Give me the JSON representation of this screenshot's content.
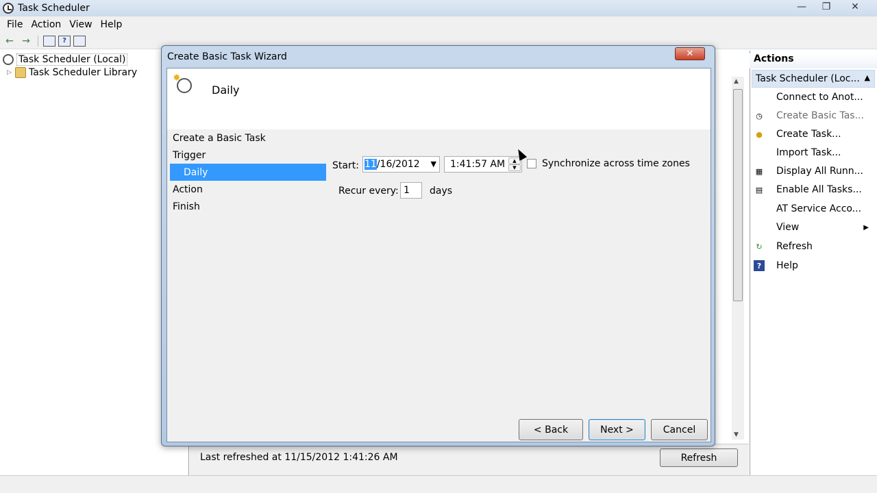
{
  "window": {
    "title": "Task Scheduler",
    "controls": {
      "minimize": "—",
      "maximize": "❐",
      "close": "✕"
    }
  },
  "menu": [
    "File",
    "Action",
    "View",
    "Help"
  ],
  "toolbar": {
    "back_icon": "←",
    "forward_icon": "→",
    "help_icon": "?"
  },
  "tree": {
    "root": "Task Scheduler (Local)",
    "library": "Task Scheduler Library"
  },
  "center": {
    "last_refreshed": "Last refreshed at 11/15/2012 1:41:26 AM",
    "refresh_label": "Refresh"
  },
  "actions": {
    "title": "Actions",
    "group": "Task Scheduler (Loc...",
    "items": [
      {
        "label": "Connect to Anot...",
        "icon": "",
        "disabled": false
      },
      {
        "label": "Create Basic Tas...",
        "icon": "clock-icon",
        "disabled": true
      },
      {
        "label": "Create Task...",
        "icon": "create-task-icon",
        "disabled": false
      },
      {
        "label": "Import Task...",
        "icon": "",
        "disabled": false
      },
      {
        "label": "Display All Runn...",
        "icon": "running-tasks-icon",
        "disabled": false
      },
      {
        "label": "Enable All Tasks...",
        "icon": "history-icon",
        "disabled": false
      },
      {
        "label": "AT Service Acco...",
        "icon": "",
        "disabled": false
      },
      {
        "label": "View",
        "icon": "",
        "disabled": false,
        "submenu": true
      },
      {
        "label": "Refresh",
        "icon": "refresh-icon",
        "disabled": false
      },
      {
        "label": "Help",
        "icon": "help-icon",
        "disabled": false
      }
    ]
  },
  "wizard": {
    "title": "Create Basic Task Wizard",
    "close_label": "✕",
    "header_title": "Daily",
    "steps": [
      {
        "label": "Create a Basic Task",
        "sub": false,
        "active": false
      },
      {
        "label": "Trigger",
        "sub": false,
        "active": false
      },
      {
        "label": "Daily",
        "sub": true,
        "active": true
      },
      {
        "label": "Action",
        "sub": false,
        "active": false
      },
      {
        "label": "Finish",
        "sub": false,
        "active": false
      }
    ],
    "form": {
      "start_label": "Start:",
      "date_month": "11",
      "date_rest": "/16/2012",
      "time": "1:41:57 AM",
      "sync_label": "Synchronize across time zones",
      "sync_checked": false,
      "recur_label": "Recur every:",
      "recur_value": "1",
      "recur_unit": "days"
    },
    "buttons": {
      "back": "< Back",
      "next": "Next >",
      "cancel": "Cancel"
    }
  }
}
